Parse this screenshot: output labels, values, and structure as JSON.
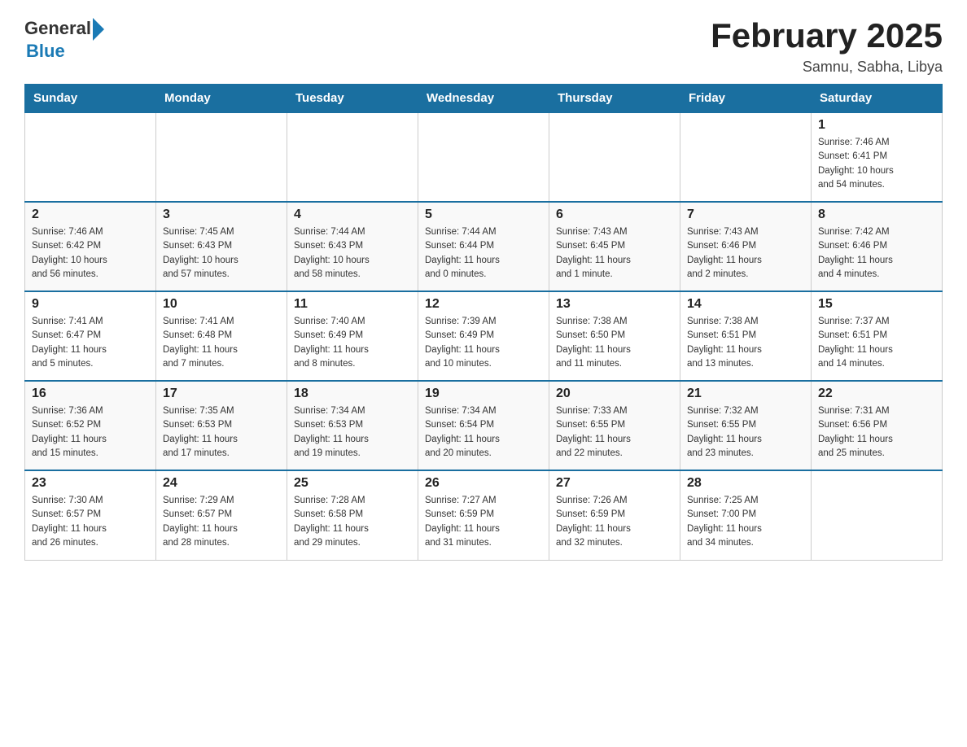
{
  "logo": {
    "general": "General",
    "blue": "Blue"
  },
  "title": "February 2025",
  "subtitle": "Samnu, Sabha, Libya",
  "days_of_week": [
    "Sunday",
    "Monday",
    "Tuesday",
    "Wednesday",
    "Thursday",
    "Friday",
    "Saturday"
  ],
  "weeks": [
    [
      {
        "day": "",
        "info": ""
      },
      {
        "day": "",
        "info": ""
      },
      {
        "day": "",
        "info": ""
      },
      {
        "day": "",
        "info": ""
      },
      {
        "day": "",
        "info": ""
      },
      {
        "day": "",
        "info": ""
      },
      {
        "day": "1",
        "info": "Sunrise: 7:46 AM\nSunset: 6:41 PM\nDaylight: 10 hours\nand 54 minutes."
      }
    ],
    [
      {
        "day": "2",
        "info": "Sunrise: 7:46 AM\nSunset: 6:42 PM\nDaylight: 10 hours\nand 56 minutes."
      },
      {
        "day": "3",
        "info": "Sunrise: 7:45 AM\nSunset: 6:43 PM\nDaylight: 10 hours\nand 57 minutes."
      },
      {
        "day": "4",
        "info": "Sunrise: 7:44 AM\nSunset: 6:43 PM\nDaylight: 10 hours\nand 58 minutes."
      },
      {
        "day": "5",
        "info": "Sunrise: 7:44 AM\nSunset: 6:44 PM\nDaylight: 11 hours\nand 0 minutes."
      },
      {
        "day": "6",
        "info": "Sunrise: 7:43 AM\nSunset: 6:45 PM\nDaylight: 11 hours\nand 1 minute."
      },
      {
        "day": "7",
        "info": "Sunrise: 7:43 AM\nSunset: 6:46 PM\nDaylight: 11 hours\nand 2 minutes."
      },
      {
        "day": "8",
        "info": "Sunrise: 7:42 AM\nSunset: 6:46 PM\nDaylight: 11 hours\nand 4 minutes."
      }
    ],
    [
      {
        "day": "9",
        "info": "Sunrise: 7:41 AM\nSunset: 6:47 PM\nDaylight: 11 hours\nand 5 minutes."
      },
      {
        "day": "10",
        "info": "Sunrise: 7:41 AM\nSunset: 6:48 PM\nDaylight: 11 hours\nand 7 minutes."
      },
      {
        "day": "11",
        "info": "Sunrise: 7:40 AM\nSunset: 6:49 PM\nDaylight: 11 hours\nand 8 minutes."
      },
      {
        "day": "12",
        "info": "Sunrise: 7:39 AM\nSunset: 6:49 PM\nDaylight: 11 hours\nand 10 minutes."
      },
      {
        "day": "13",
        "info": "Sunrise: 7:38 AM\nSunset: 6:50 PM\nDaylight: 11 hours\nand 11 minutes."
      },
      {
        "day": "14",
        "info": "Sunrise: 7:38 AM\nSunset: 6:51 PM\nDaylight: 11 hours\nand 13 minutes."
      },
      {
        "day": "15",
        "info": "Sunrise: 7:37 AM\nSunset: 6:51 PM\nDaylight: 11 hours\nand 14 minutes."
      }
    ],
    [
      {
        "day": "16",
        "info": "Sunrise: 7:36 AM\nSunset: 6:52 PM\nDaylight: 11 hours\nand 15 minutes."
      },
      {
        "day": "17",
        "info": "Sunrise: 7:35 AM\nSunset: 6:53 PM\nDaylight: 11 hours\nand 17 minutes."
      },
      {
        "day": "18",
        "info": "Sunrise: 7:34 AM\nSunset: 6:53 PM\nDaylight: 11 hours\nand 19 minutes."
      },
      {
        "day": "19",
        "info": "Sunrise: 7:34 AM\nSunset: 6:54 PM\nDaylight: 11 hours\nand 20 minutes."
      },
      {
        "day": "20",
        "info": "Sunrise: 7:33 AM\nSunset: 6:55 PM\nDaylight: 11 hours\nand 22 minutes."
      },
      {
        "day": "21",
        "info": "Sunrise: 7:32 AM\nSunset: 6:55 PM\nDaylight: 11 hours\nand 23 minutes."
      },
      {
        "day": "22",
        "info": "Sunrise: 7:31 AM\nSunset: 6:56 PM\nDaylight: 11 hours\nand 25 minutes."
      }
    ],
    [
      {
        "day": "23",
        "info": "Sunrise: 7:30 AM\nSunset: 6:57 PM\nDaylight: 11 hours\nand 26 minutes."
      },
      {
        "day": "24",
        "info": "Sunrise: 7:29 AM\nSunset: 6:57 PM\nDaylight: 11 hours\nand 28 minutes."
      },
      {
        "day": "25",
        "info": "Sunrise: 7:28 AM\nSunset: 6:58 PM\nDaylight: 11 hours\nand 29 minutes."
      },
      {
        "day": "26",
        "info": "Sunrise: 7:27 AM\nSunset: 6:59 PM\nDaylight: 11 hours\nand 31 minutes."
      },
      {
        "day": "27",
        "info": "Sunrise: 7:26 AM\nSunset: 6:59 PM\nDaylight: 11 hours\nand 32 minutes."
      },
      {
        "day": "28",
        "info": "Sunrise: 7:25 AM\nSunset: 7:00 PM\nDaylight: 11 hours\nand 34 minutes."
      },
      {
        "day": "",
        "info": ""
      }
    ]
  ]
}
